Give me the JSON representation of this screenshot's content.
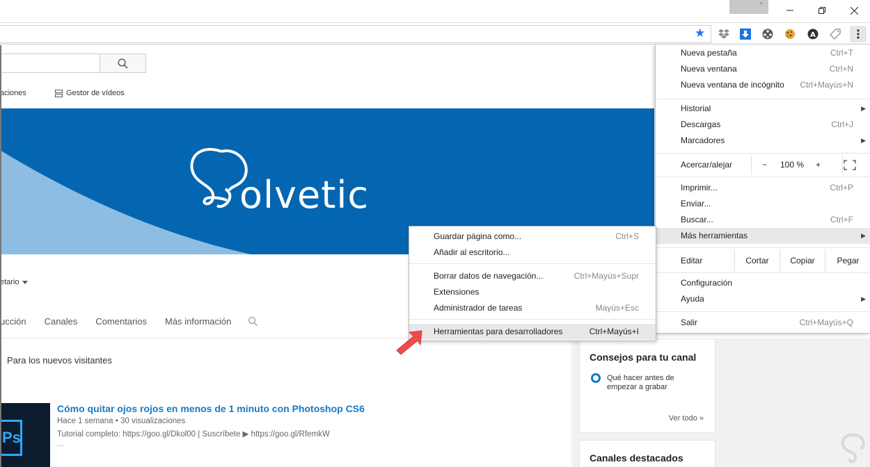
{
  "window": {
    "profile_marker": "°"
  },
  "toolbar": {
    "extensions": [
      "dropbox-icon",
      "download-icon",
      "film-reel-icon",
      "cookie-icon",
      "a-circle-icon",
      "tag-icon"
    ]
  },
  "youtube": {
    "nav_partial": "aciones",
    "nav_gestor": "Gestor de vídeos",
    "banner_text": "olvetic",
    "owner_dropdown": "etario",
    "tabs": [
      "ucción",
      "Canales",
      "Comentarios",
      "Más información"
    ],
    "visitors_label": "Para los nuevos visitantes",
    "video": {
      "title": "Cómo quitar ojos rojos en menos de 1 minuto con Photoshop CS6",
      "meta": "Hace 1 semana • 30 visualizaciones",
      "desc": "Tutorial completo: https://goo.gl/Dkol00 | Suscríbete ▶ https://goo.gl/RfemkW",
      "more": "...",
      "thumb_text": "Ps"
    },
    "tips_card": {
      "title": "Consejos para tu canal",
      "item": "Qué hacer antes de empezar a grabar",
      "see_all": "Ver todo »"
    },
    "channels_card": {
      "title": "Canales destacados"
    }
  },
  "chrome_menu": {
    "new_tab": {
      "label": "Nueva pestaña",
      "shortcut": "Ctrl+T"
    },
    "new_window": {
      "label": "Nueva ventana",
      "shortcut": "Ctrl+N"
    },
    "incognito": {
      "label": "Nueva ventana de incógnito",
      "shortcut": "Ctrl+Mayús+N"
    },
    "history": {
      "label": "Historial"
    },
    "downloads": {
      "label": "Descargas",
      "shortcut": "Ctrl+J"
    },
    "bookmarks": {
      "label": "Marcadores"
    },
    "zoom": {
      "label": "Acercar/alejar",
      "minus": "−",
      "value": "100 %",
      "plus": "+"
    },
    "print": {
      "label": "Imprimir...",
      "shortcut": "Ctrl+P"
    },
    "send": {
      "label": "Enviar..."
    },
    "find": {
      "label": "Buscar...",
      "shortcut": "Ctrl+F"
    },
    "more_tools": {
      "label": "Más herramientas"
    },
    "edit": {
      "label": "Editar",
      "cut": "Cortar",
      "copy": "Copiar",
      "paste": "Pegar"
    },
    "settings": {
      "label": "Configuración"
    },
    "help": {
      "label": "Ayuda"
    },
    "exit": {
      "label": "Salir",
      "shortcut": "Ctrl+Mayús+Q"
    }
  },
  "more_tools_menu": {
    "save_page": {
      "label": "Guardar página como...",
      "shortcut": "Ctrl+S"
    },
    "add_desktop": {
      "label": "Añadir al escritorio..."
    },
    "clear_data": {
      "label": "Borrar datos de navegación...",
      "shortcut": "Ctrl+Mayús+Supr"
    },
    "extensions": {
      "label": "Extensiones"
    },
    "task_manager": {
      "label": "Administrador de tareas",
      "shortcut": "Mayús+Esc"
    },
    "dev_tools": {
      "label": "Herramientas para desarrolladores",
      "shortcut": "Ctrl+Mayús+I"
    }
  },
  "colors": {
    "accent_blue": "#167ac6",
    "banner_blue": "#0466b1",
    "pointer_red": "#f04a4a"
  }
}
